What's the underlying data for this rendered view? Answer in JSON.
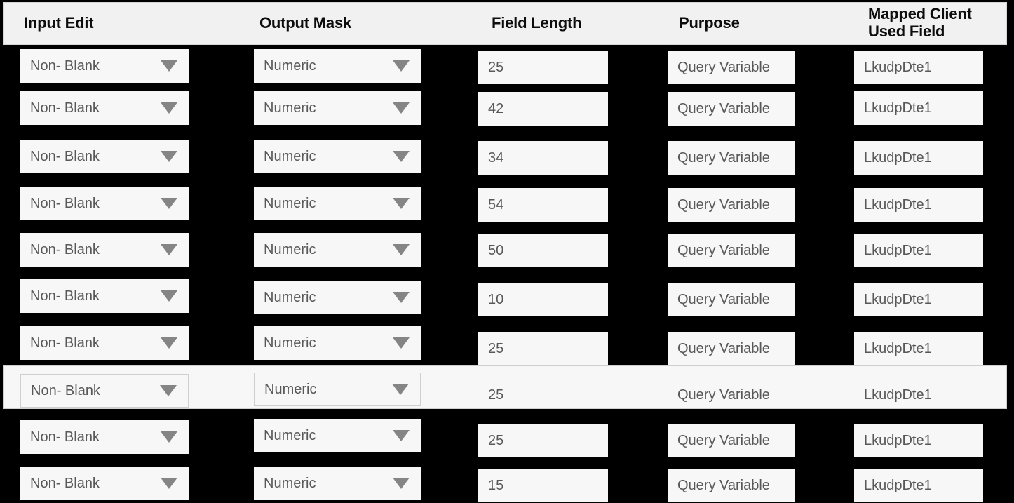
{
  "table": {
    "columns": [
      {
        "key": "input_edit",
        "label": "Input Edit",
        "type": "dropdown"
      },
      {
        "key": "output_mask",
        "label": "Output Mask",
        "type": "dropdown"
      },
      {
        "key": "field_length",
        "label": "Field Length",
        "type": "text"
      },
      {
        "key": "purpose",
        "label": "Purpose",
        "type": "text"
      },
      {
        "key": "mapped_field",
        "label": "Mapped Client Used Field",
        "type": "text"
      }
    ],
    "header": {
      "col0": "Input Edit",
      "col1": "Output Mask",
      "col2": "Field Length",
      "col3": "Purpose",
      "col4_line1": "Mapped Client",
      "col4_line2": "Used Field"
    },
    "rows": [
      {
        "input_edit": "Non- Blank",
        "output_mask": "Numeric",
        "field_length": "25",
        "purpose": "Query Variable",
        "mapped_field": "LkudpDte1",
        "highlighted": false
      },
      {
        "input_edit": "Non- Blank",
        "output_mask": "Numeric",
        "field_length": "42",
        "purpose": "Query Variable",
        "mapped_field": "LkudpDte1",
        "highlighted": false
      },
      {
        "input_edit": "Non- Blank",
        "output_mask": "Numeric",
        "field_length": "34",
        "purpose": "Query Variable",
        "mapped_field": "LkudpDte1",
        "highlighted": false
      },
      {
        "input_edit": "Non- Blank",
        "output_mask": "Numeric",
        "field_length": "54",
        "purpose": "Query Variable",
        "mapped_field": "LkudpDte1",
        "highlighted": false
      },
      {
        "input_edit": "Non- Blank",
        "output_mask": "Numeric",
        "field_length": "50",
        "purpose": "Query Variable",
        "mapped_field": "LkudpDte1",
        "highlighted": false
      },
      {
        "input_edit": "Non- Blank",
        "output_mask": "Numeric",
        "field_length": "10",
        "purpose": "Query Variable",
        "mapped_field": "LkudpDte1",
        "highlighted": false
      },
      {
        "input_edit": "Non- Blank",
        "output_mask": "Numeric",
        "field_length": "25",
        "purpose": "Query Variable",
        "mapped_field": "LkudpDte1",
        "highlighted": false
      },
      {
        "input_edit": "Non- Blank",
        "output_mask": "Numeric",
        "field_length": "25",
        "purpose": "Query Variable",
        "mapped_field": "LkudpDte1",
        "highlighted": true
      },
      {
        "input_edit": "Non- Blank",
        "output_mask": "Numeric",
        "field_length": "25",
        "purpose": "Query Variable",
        "mapped_field": "LkudpDte1",
        "highlighted": false
      },
      {
        "input_edit": "Non- Blank",
        "output_mask": "Numeric",
        "field_length": "15",
        "purpose": "Query Variable",
        "mapped_field": "LkudpDte1",
        "highlighted": false
      }
    ],
    "icons": {
      "dropdown": "chevron-down-icon"
    },
    "colors": {
      "page_background": "#000000",
      "header_background": "#f1f1f1",
      "field_background": "#f7f7f7",
      "field_text": "#585858",
      "header_text": "#0d0d0d",
      "caret": "#858585",
      "field_border": "#cfcfcf"
    }
  }
}
